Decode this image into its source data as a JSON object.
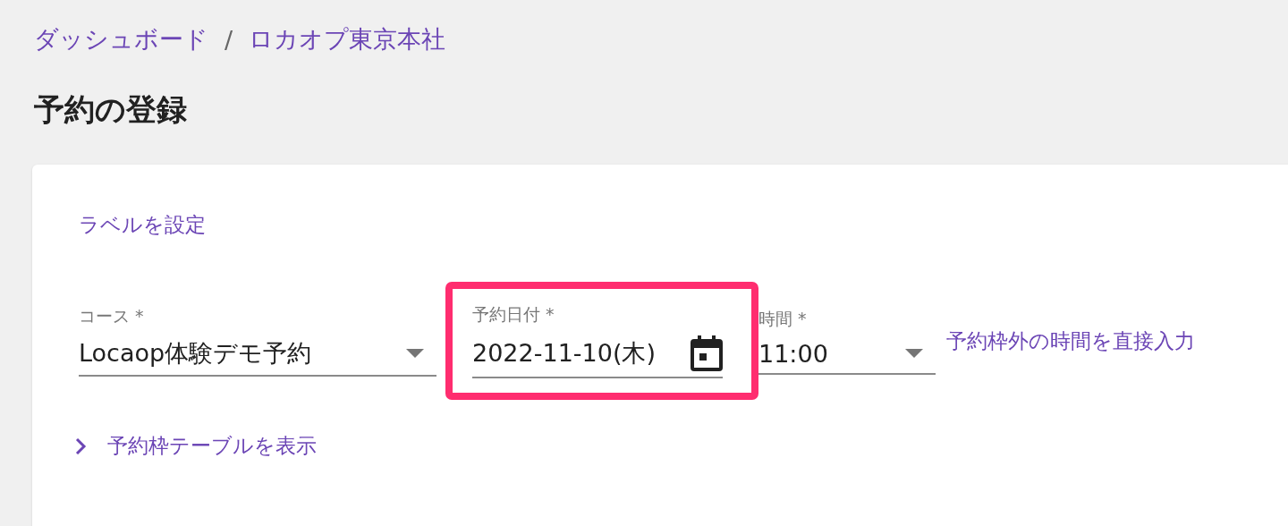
{
  "breadcrumb_separator": "/",
  "breadcrumb": [
    {
      "label": "ダッシュボード"
    },
    {
      "label": "ロカオプ東京本社"
    }
  ],
  "page_title": "予約の登録",
  "label_link": "ラベルを設定",
  "fields": [
    {
      "kind": "select",
      "label": "コース *",
      "value": "Locaop体験デモ予約",
      "highlighted": false
    },
    {
      "kind": "date",
      "label": "予約日付 *",
      "value": "2022-11-10(木)",
      "highlighted": true
    },
    {
      "kind": "select",
      "label": "時間 *",
      "value": "11:00",
      "highlighted": false
    }
  ],
  "direct_input_link": "予約枠外の時間を直接入力",
  "slot_table_toggle": {
    "label": "予約枠テーブルを表示",
    "expanded": false
  }
}
